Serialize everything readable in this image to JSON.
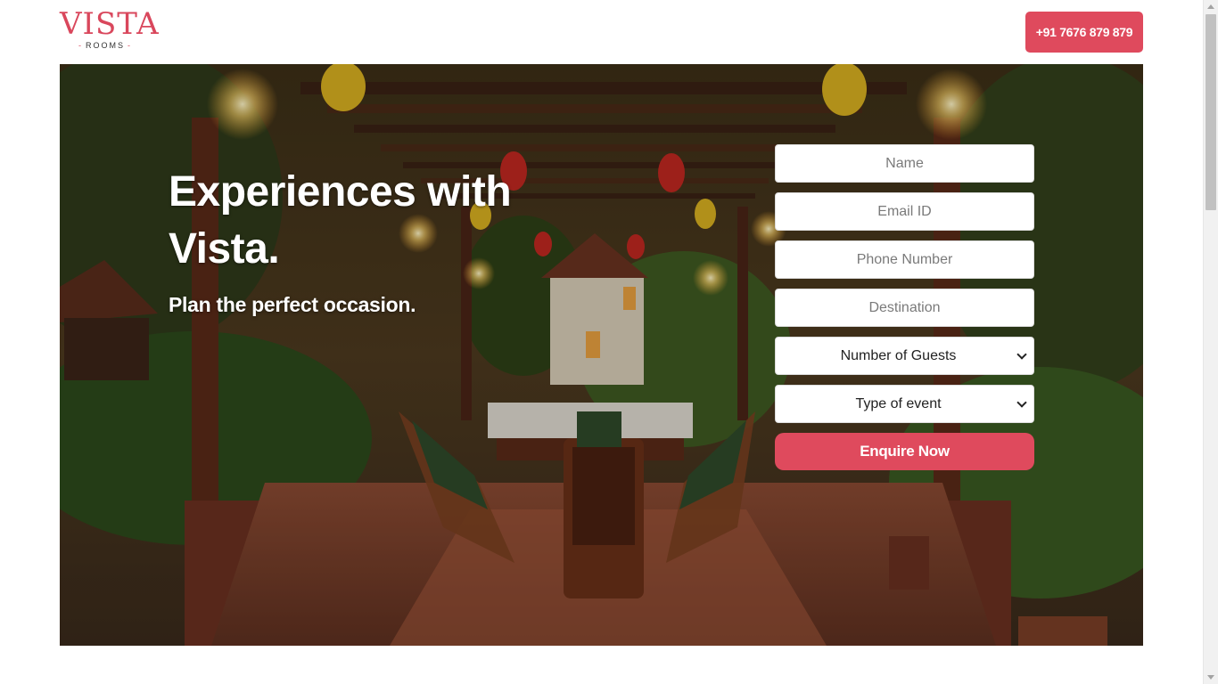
{
  "header": {
    "logo_text": "VISTA",
    "logo_sub": "ROOMS",
    "phone_label": "+91 7676 879 879"
  },
  "hero": {
    "title": "Experiences with Vista.",
    "subtitle": "Plan the perfect occasion."
  },
  "form": {
    "name_placeholder": "Name",
    "email_placeholder": "Email ID",
    "phone_placeholder": "Phone Number",
    "destination_placeholder": "Destination",
    "guests_selected": "Number of Guests",
    "event_selected": "Type of event",
    "submit_label": "Enquire Now"
  },
  "colors": {
    "accent": "#df4a5d",
    "logo": "#d9475c"
  }
}
